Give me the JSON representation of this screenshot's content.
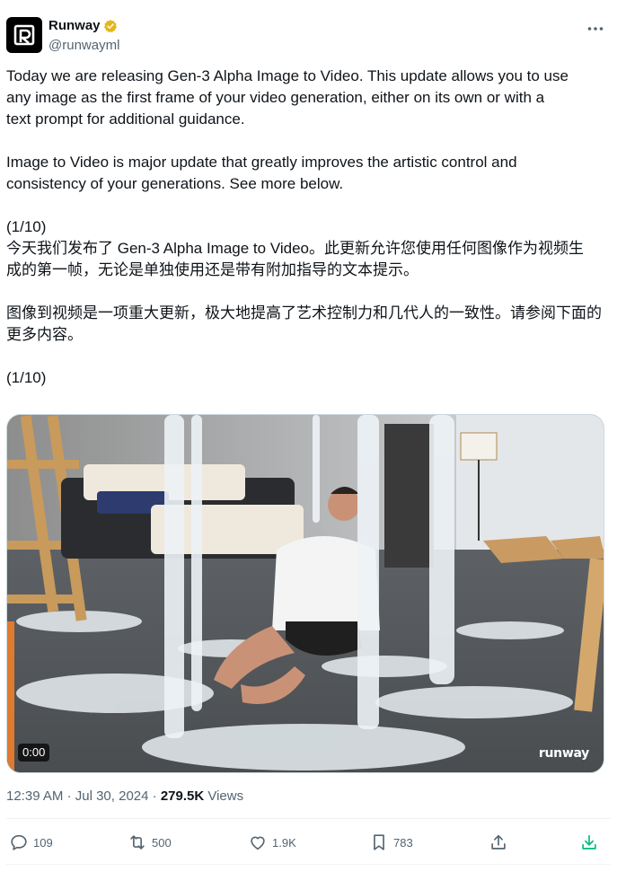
{
  "author": {
    "display_name": "Runway",
    "handle": "@runwayml",
    "verified_badge": "gold-check",
    "avatar_icon": "runway-logo"
  },
  "tweet": {
    "paragraphs": [
      "Today we are releasing Gen-3 Alpha Image to Video. This update allows you to use\nany image as the first frame of your video generation, either on its own or with a\ntext prompt for additional guidance.",
      "Image to Video is major update that greatly improves the artistic control and\nconsistency of your generations. See more below.",
      "(1/10)\n今天我们发布了 Gen-3 Alpha Image to Video。此更新允许您使用任何图像作为视频生\n成的第一帧，无论是单独使用还是带有附加指导的文本提示。",
      "图像到视频是一项重大更新，极大地提高了艺术控制力和几代人的一致性。请参阅下面的\n更多内容。",
      "(1/10)"
    ]
  },
  "media": {
    "type": "video",
    "time": "0:00",
    "watermark": "runway"
  },
  "meta": {
    "time": "12:39 AM",
    "separator": "·",
    "date": "Jul 30, 2024",
    "views_count": "279.5K",
    "views_label": "Views"
  },
  "actions": {
    "replies": "109",
    "reposts": "500",
    "likes": "1.9K",
    "bookmarks": "783"
  },
  "colors": {
    "text": "#0f1419",
    "secondary": "#536471",
    "border": "#cfd9de",
    "verified": "#e2b719",
    "download": "#00ba7c"
  }
}
